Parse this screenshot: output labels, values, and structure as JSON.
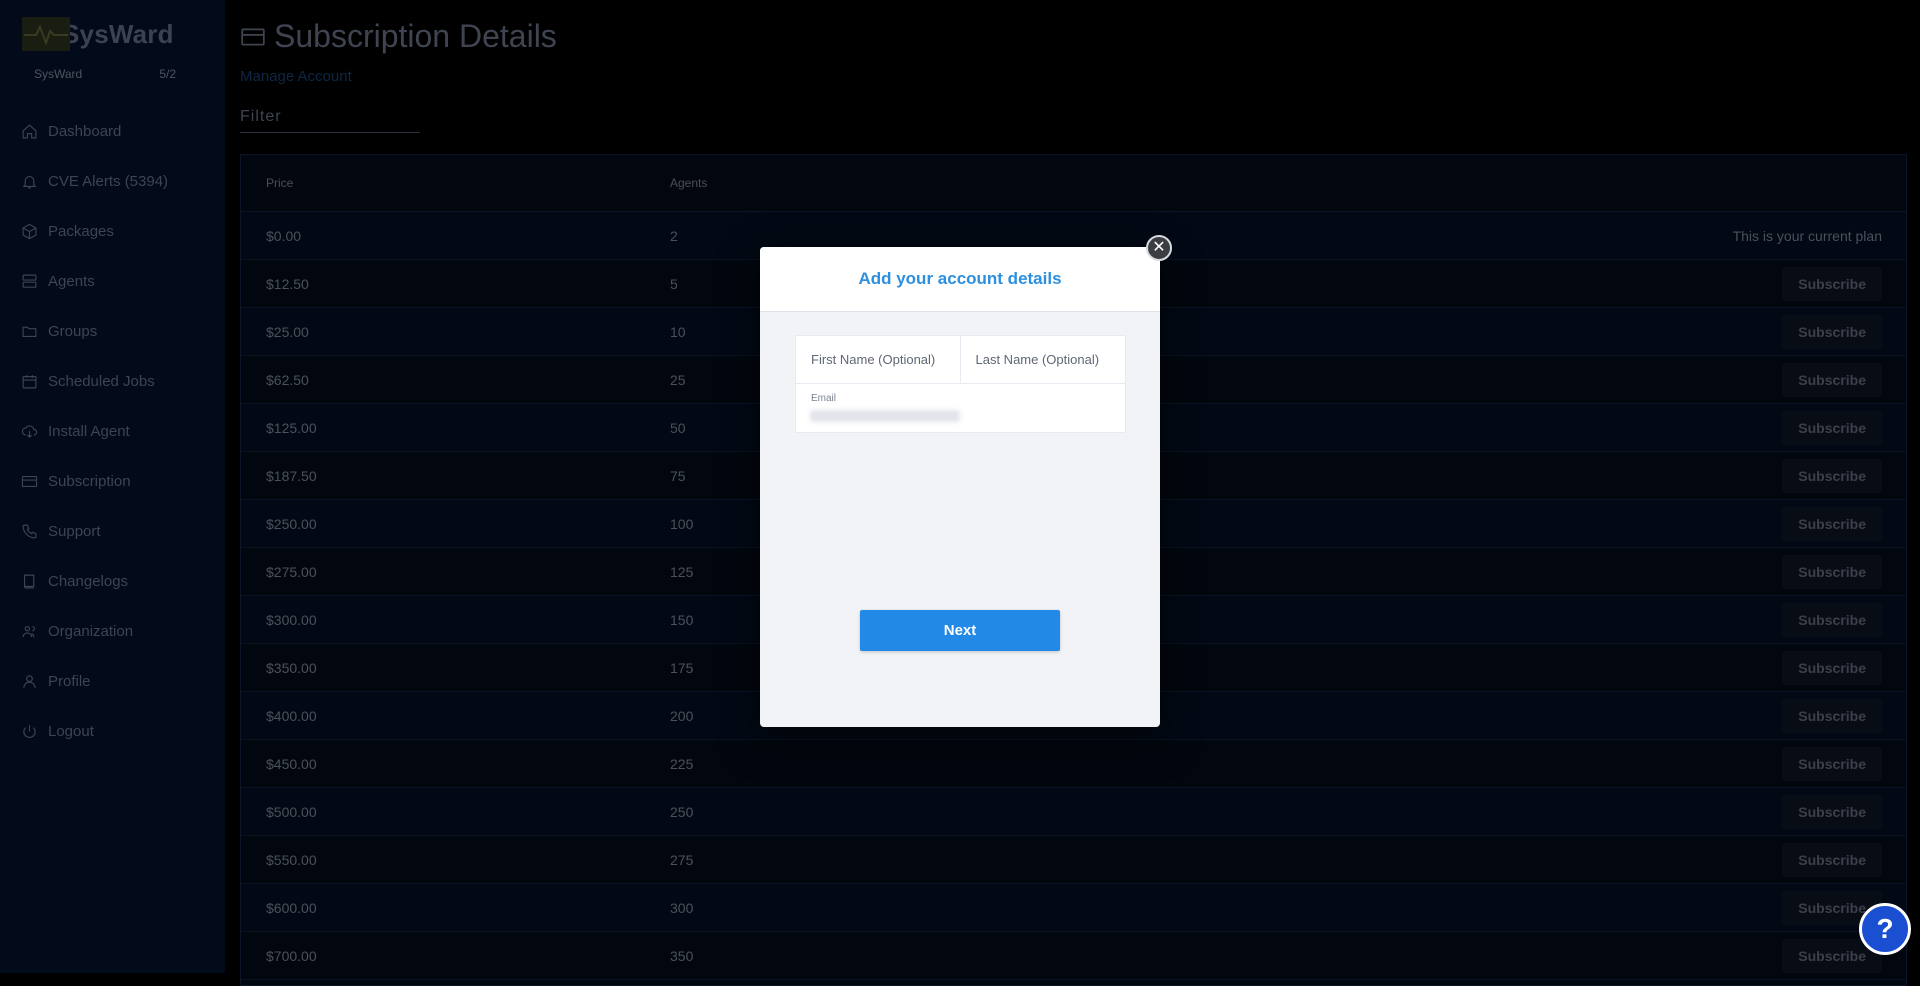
{
  "brand": {
    "name": "SysWard",
    "org_name": "SysWard",
    "plan_count": "5/2"
  },
  "sidebar": {
    "items": [
      {
        "label": "Dashboard",
        "icon": "home-icon"
      },
      {
        "label": "CVE Alerts (5394)",
        "icon": "bell-icon"
      },
      {
        "label": "Packages",
        "icon": "box-icon"
      },
      {
        "label": "Agents",
        "icon": "server-icon"
      },
      {
        "label": "Groups",
        "icon": "folder-icon"
      },
      {
        "label": "Scheduled Jobs",
        "icon": "calendar-icon"
      },
      {
        "label": "Install Agent",
        "icon": "cloud-download-icon"
      },
      {
        "label": "Subscription",
        "icon": "credit-card-icon"
      },
      {
        "label": "Support",
        "icon": "phone-icon"
      },
      {
        "label": "Changelogs",
        "icon": "book-icon"
      },
      {
        "label": "Organization",
        "icon": "users-icon"
      },
      {
        "label": "Profile",
        "icon": "user-icon"
      },
      {
        "label": "Logout",
        "icon": "power-icon"
      }
    ]
  },
  "main": {
    "title": "Subscription Details",
    "manage_link": "Manage Account",
    "filter_placeholder": "Filter",
    "table": {
      "headers": {
        "price": "Price",
        "agents": "Agents"
      },
      "current_plan_text": "This is your current plan",
      "subscribe_label": "Subscribe",
      "rows": [
        {
          "price": "$0.00",
          "agents": "2",
          "current": true
        },
        {
          "price": "$12.50",
          "agents": "5"
        },
        {
          "price": "$25.00",
          "agents": "10"
        },
        {
          "price": "$62.50",
          "agents": "25"
        },
        {
          "price": "$125.00",
          "agents": "50"
        },
        {
          "price": "$187.50",
          "agents": "75"
        },
        {
          "price": "$250.00",
          "agents": "100"
        },
        {
          "price": "$275.00",
          "agents": "125"
        },
        {
          "price": "$300.00",
          "agents": "150"
        },
        {
          "price": "$350.00",
          "agents": "175"
        },
        {
          "price": "$400.00",
          "agents": "200"
        },
        {
          "price": "$450.00",
          "agents": "225"
        },
        {
          "price": "$500.00",
          "agents": "250"
        },
        {
          "price": "$550.00",
          "agents": "275"
        },
        {
          "price": "$600.00",
          "agents": "300"
        },
        {
          "price": "$700.00",
          "agents": "350"
        }
      ]
    }
  },
  "modal": {
    "title": "Add your account details",
    "first_name_placeholder": "First Name (Optional)",
    "last_name_placeholder": "Last Name (Optional)",
    "email_label": "Email",
    "next_label": "Next",
    "close_symbol": "✕"
  },
  "help": {
    "symbol": "?"
  },
  "colors": {
    "accent": "#2289e6",
    "modal_title": "#2d8fde",
    "sidebar_bg": "#030a19",
    "help_fab": "#1b4fd1"
  }
}
